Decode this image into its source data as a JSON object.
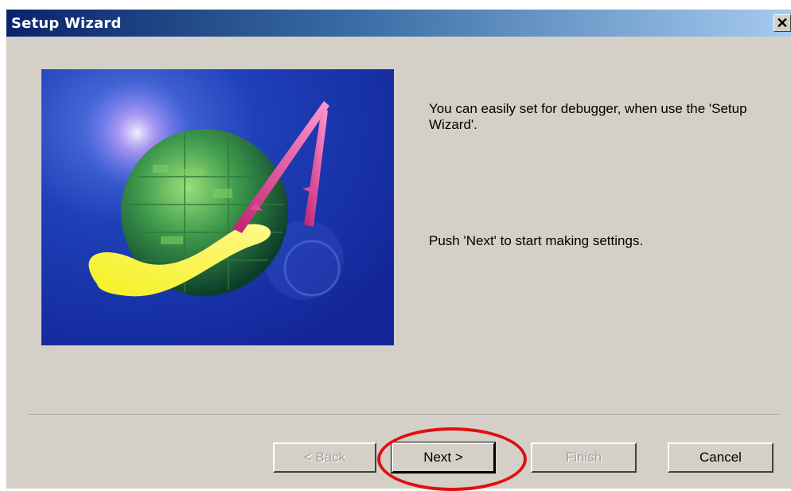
{
  "window": {
    "title": "Setup Wizard",
    "close_symbol": "✕"
  },
  "content": {
    "text_line1": "You can easily set for debugger, when use the 'Setup Wizard'.",
    "text_line2": "Push 'Next' to start making settings."
  },
  "buttons": {
    "back": "< Back",
    "next": "Next >",
    "finish": "Finish",
    "cancel": "Cancel"
  },
  "colors": {
    "titlebar_start": "#0a246a",
    "dialog_bg": "#d4d0c8",
    "illustration_bg": "#1e3fb0",
    "highlight": "#e01010"
  },
  "icons": {
    "illustration": "globe-with-probes-image",
    "close": "close-icon"
  }
}
